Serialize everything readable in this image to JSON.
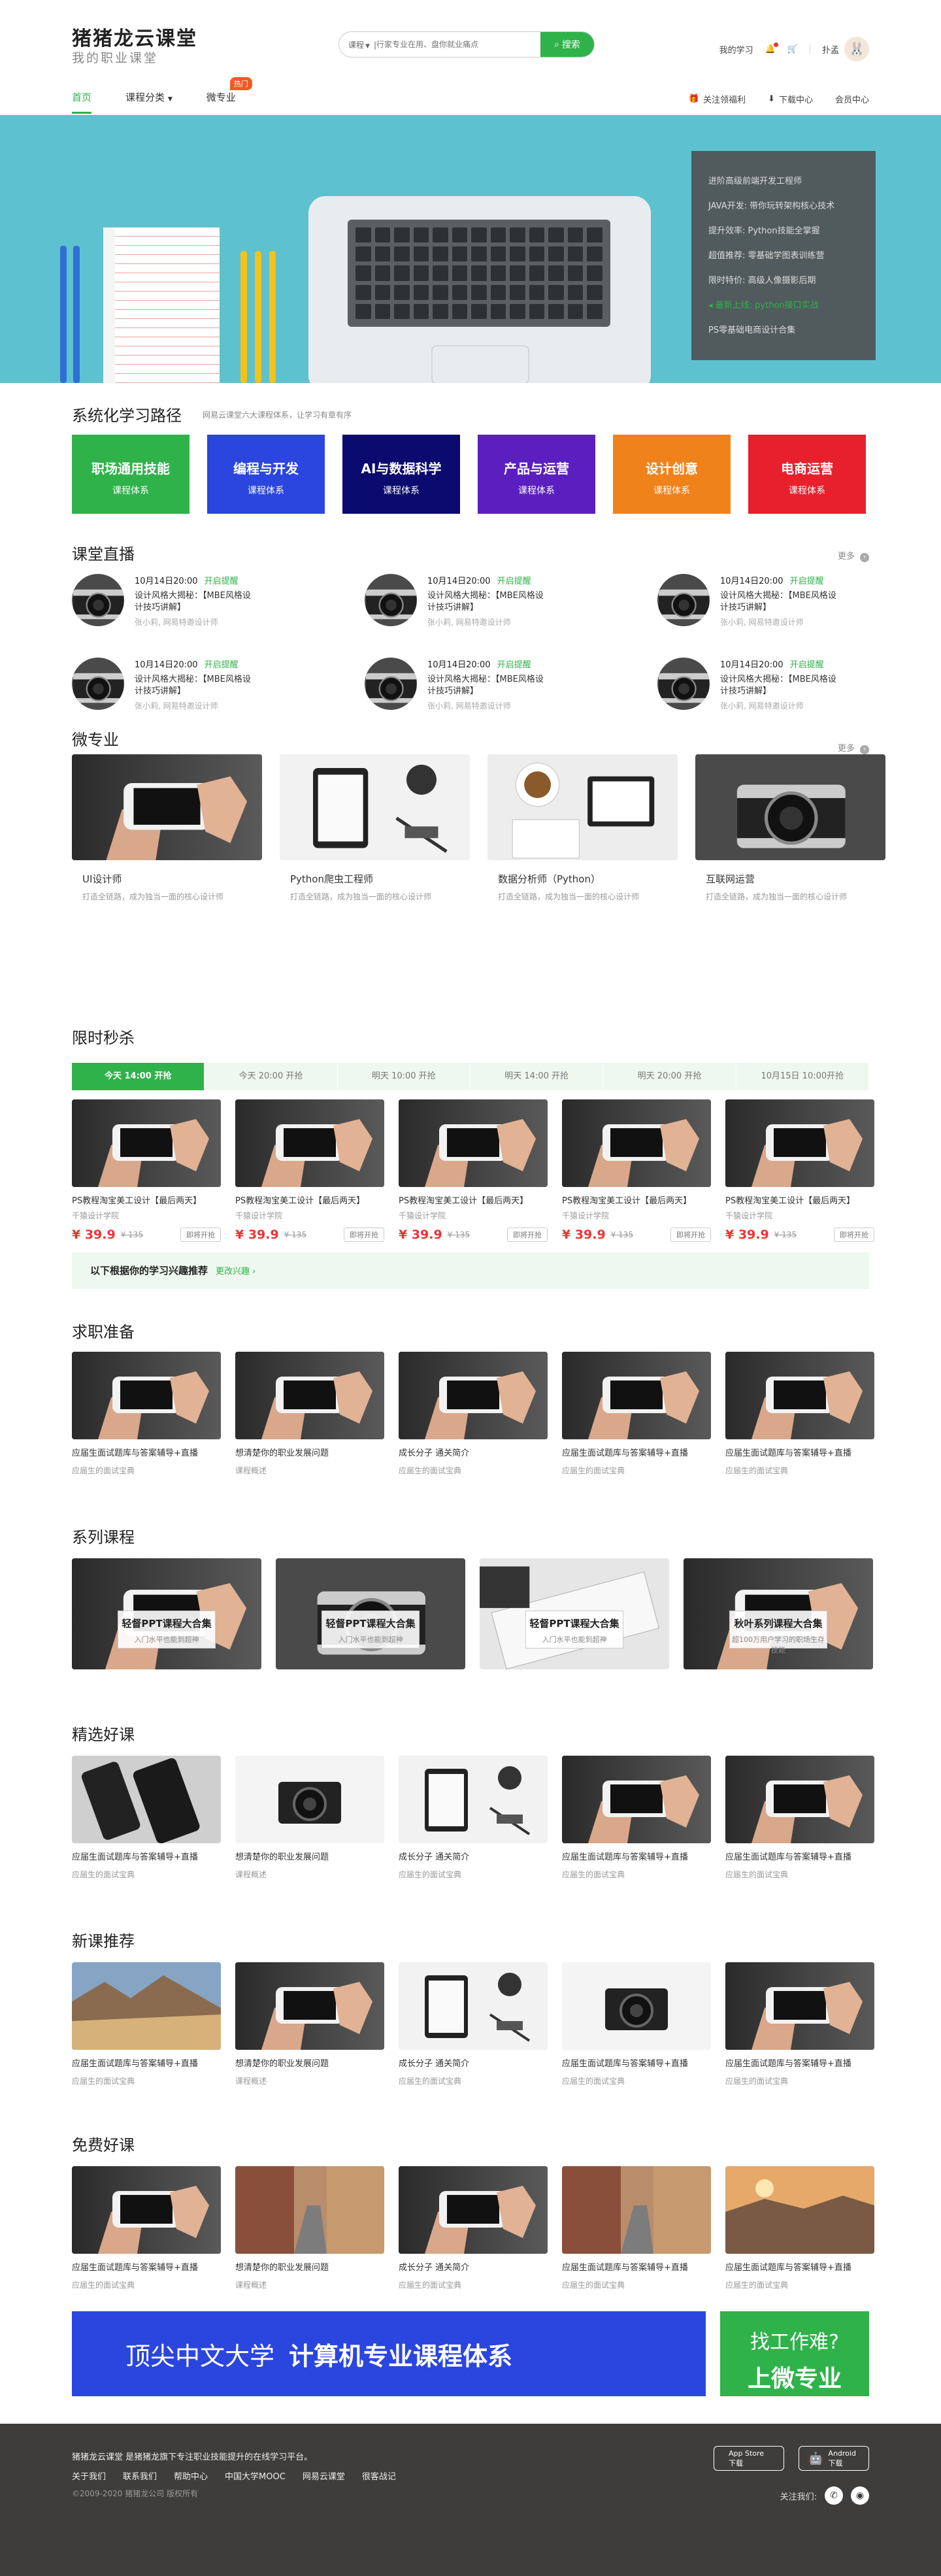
{
  "header": {
    "logo_title": "猪猪龙云课堂",
    "logo_sub": "我的职业课堂",
    "search_category": "课程",
    "search_placeholder": "行家专业在用、盘你就业痛点",
    "search_button": "搜索",
    "my_study": "我的学习",
    "username": "扑孟"
  },
  "nav": {
    "items": [
      "首页",
      "课程分类",
      "微专业"
    ],
    "hot_badge": "热门",
    "right": [
      "关注领福利",
      "下载中心",
      "会员中心"
    ]
  },
  "banner": {
    "side_items": [
      "进阶高级前端开发工程师",
      "JAVA开发: 带你玩转架构核心技术",
      "提升效率: Python技能全掌握",
      "超值推荐: 零基础学图表训练营",
      "限时特价: 高级人像摄影后期",
      "最新上线: python接口实战",
      "PS零基础电商设计合集"
    ]
  },
  "paths": {
    "title": "系统化学习路径",
    "desc": "网易云课堂六大课程体系，让学习有章有序",
    "items": [
      {
        "name": "职场通用技能",
        "sub": "课程体系",
        "color": "#2fb24a"
      },
      {
        "name": "编程与开发",
        "sub": "课程体系",
        "color": "#2b46de"
      },
      {
        "name": "AI与数据科学",
        "sub": "课程体系",
        "color": "#0b0a6e"
      },
      {
        "name": "产品与运营",
        "sub": "课程体系",
        "color": "#5b1fbf"
      },
      {
        "name": "设计创意",
        "sub": "课程体系",
        "color": "#f0821c"
      },
      {
        "name": "电商运营",
        "sub": "课程体系",
        "color": "#e8202c"
      }
    ]
  },
  "live": {
    "title": "课堂直播",
    "more": "更多",
    "items": [
      {
        "time": "10月14日20:00",
        "status": "开启提醒",
        "title": "设计风格大揭秘：【MBE风格设计技巧讲解】",
        "author": "张小莉, 网易特邀设计师"
      },
      {
        "time": "10月14日20:00",
        "status": "开启提醒",
        "title": "设计风格大揭秘：【MBE风格设计技巧讲解】",
        "author": "张小莉, 网易特邀设计师"
      },
      {
        "time": "10月14日20:00",
        "status": "开启提醒",
        "title": "设计风格大揭秘：【MBE风格设计技巧讲解】",
        "author": "张小莉, 网易特邀设计师"
      },
      {
        "time": "10月14日20:00",
        "status": "开启提醒",
        "title": "设计风格大揭秘：【MBE风格设计技巧讲解】",
        "author": "张小莉, 网易特邀设计师"
      },
      {
        "time": "10月14日20:00",
        "status": "开启提醒",
        "title": "设计风格大揭秘：【MBE风格设计技巧讲解】",
        "author": "张小莉, 网易特邀设计师"
      },
      {
        "time": "10月14日20:00",
        "status": "开启提醒",
        "title": "设计风格大揭秘：【MBE风格设计技巧讲解】",
        "author": "张小莉, 网易特邀设计师"
      }
    ]
  },
  "micro": {
    "title": "微专业",
    "more": "更多",
    "items": [
      {
        "title": "UI设计师",
        "desc": "打造全链路，成为独当一面的核心设计师",
        "img": "phone"
      },
      {
        "title": "Python爬虫工程师",
        "desc": "打造全链路，成为独当一面的核心设计师",
        "img": "tablet"
      },
      {
        "title": "数据分析师（Python）",
        "desc": "打造全链路，成为独当一面的核心设计师",
        "img": "coffee"
      },
      {
        "title": "互联网运营",
        "desc": "打造全链路，成为独当一面的核心设计师",
        "img": "camera"
      }
    ]
  },
  "flash": {
    "title": "限时秒杀",
    "tabs": [
      "今天 14:00 开抢",
      "今天 20:00 开抢",
      "明天 10:00 开抢",
      "明天 14:00 开抢",
      "明天 20:00 开抢",
      "10月15日 10:00开抢"
    ],
    "items": [
      {
        "title": "PS教程淘宝美工设计【最后两天】",
        "school": "千猿设计学院",
        "price": "¥ 39.9",
        "orig": "¥ 135",
        "btn": "即将开抢"
      },
      {
        "title": "PS教程淘宝美工设计【最后两天】",
        "school": "千猿设计学院",
        "price": "¥ 39.9",
        "orig": "¥ 135",
        "btn": "即将开抢"
      },
      {
        "title": "PS教程淘宝美工设计【最后两天】",
        "school": "千猿设计学院",
        "price": "¥ 39.9",
        "orig": "¥ 135",
        "btn": "即将开抢"
      },
      {
        "title": "PS教程淘宝美工设计【最后两天】",
        "school": "千猿设计学院",
        "price": "¥ 39.9",
        "orig": "¥ 135",
        "btn": "即将开抢"
      },
      {
        "title": "PS教程淘宝美工设计【最后两天】",
        "school": "千猿设计学院",
        "price": "¥ 39.9",
        "orig": "¥ 135",
        "btn": "即将开抢"
      }
    ],
    "rec_text": "以下根据你的学习兴趣推荐",
    "rec_change": "更改兴趣 ›"
  },
  "job": {
    "title": "求职准备",
    "items": [
      {
        "title": "应届生面试题库与答案辅导+直播",
        "desc": "应届生的面试宝典",
        "img": "phone"
      },
      {
        "title": "想清楚你的职业发展问题",
        "desc": "课程概述",
        "img": "phone"
      },
      {
        "title": "成长分子 通关简介",
        "desc": "应届生的面试宝典",
        "img": "phone"
      },
      {
        "title": "应届生面试题库与答案辅导+直播",
        "desc": "应届生的面试宝典",
        "img": "phone"
      },
      {
        "title": "应届生面试题库与答案辅导+直播",
        "desc": "应届生的面试宝典",
        "img": "phone"
      }
    ]
  },
  "series": {
    "title": "系列课程",
    "items": [
      {
        "title": "轻督PPT课程大合集",
        "sub": "入门水平也能到超神",
        "img": "phone"
      },
      {
        "title": "轻督PPT课程大合集",
        "sub": "入门水平也能到超神",
        "img": "camera"
      },
      {
        "title": "轻督PPT课程大合集",
        "sub": "入门水平也能到超神",
        "img": "keyboard"
      },
      {
        "title": "秋叶系列课程大合集",
        "sub": "超100万用户学习的职场生存技能",
        "img": "phone"
      }
    ]
  },
  "featured": {
    "title": "精选好课",
    "items": [
      {
        "title": "应届生面试题库与答案辅导+直播",
        "desc": "应届生的面试宝典",
        "img": "phones"
      },
      {
        "title": "想清楚你的职业发展问题",
        "desc": "课程概述",
        "img": "camera-white"
      },
      {
        "title": "成长分子 通关简介",
        "desc": "应届生的面试宝典",
        "img": "tablet"
      },
      {
        "title": "应届生面试题库与答案辅导+直播",
        "desc": "应届生的面试宝典",
        "img": "phone"
      },
      {
        "title": "应届生面试题库与答案辅导+直播",
        "desc": "应届生的面试宝典",
        "img": "phone"
      }
    ]
  },
  "newc": {
    "title": "新课推荐",
    "items": [
      {
        "title": "应届生面试题库与答案辅导+直播",
        "desc": "应届生的面试宝典",
        "img": "landscape"
      },
      {
        "title": "想清楚你的职业发展问题",
        "desc": "课程概述",
        "img": "phone"
      },
      {
        "title": "成长分子 通关简介",
        "desc": "应届生的面试宝典",
        "img": "tablet"
      },
      {
        "title": "应届生面试题库与答案辅导+直播",
        "desc": "应届生的面试宝典",
        "img": "camera-white"
      },
      {
        "title": "应届生面试题库与答案辅导+直播",
        "desc": "应届生的面试宝典",
        "img": "phone"
      }
    ]
  },
  "free": {
    "title": "免费好课",
    "items": [
      {
        "title": "应届生面试题库与答案辅导+直播",
        "desc": "应届生的面试宝典",
        "img": "phone"
      },
      {
        "title": "想清楚你的职业发展问题",
        "desc": "课程概述",
        "img": "street"
      },
      {
        "title": "成长分子 通关简介",
        "desc": "应届生的面试宝典",
        "img": "phone"
      },
      {
        "title": "应届生面试题库与答案辅导+直播",
        "desc": "应届生的面试宝典",
        "img": "street"
      },
      {
        "title": "应届生面试题库与答案辅导+直播",
        "desc": "应届生的面试宝典",
        "img": "sunset"
      }
    ]
  },
  "ad": {
    "left_a": "顶尖中文大学",
    "left_b": "计算机专业课程体系",
    "right_a": "找工作难?",
    "right_b": "上微专业"
  },
  "footer": {
    "line1": "猪猪龙云课堂 是猪猪龙旗下专注职业技能提升的在线学习平台。",
    "links": [
      "关于我们",
      "联系我们",
      "帮助中心",
      "中国大学MOOC",
      "网易云课堂",
      "很客战记"
    ],
    "copy": "©2009-2020 猪猪龙公司 版权所有",
    "app1": "App Store",
    "app2": "Android",
    "app_sub": "下载",
    "follow": "关注我们:"
  }
}
